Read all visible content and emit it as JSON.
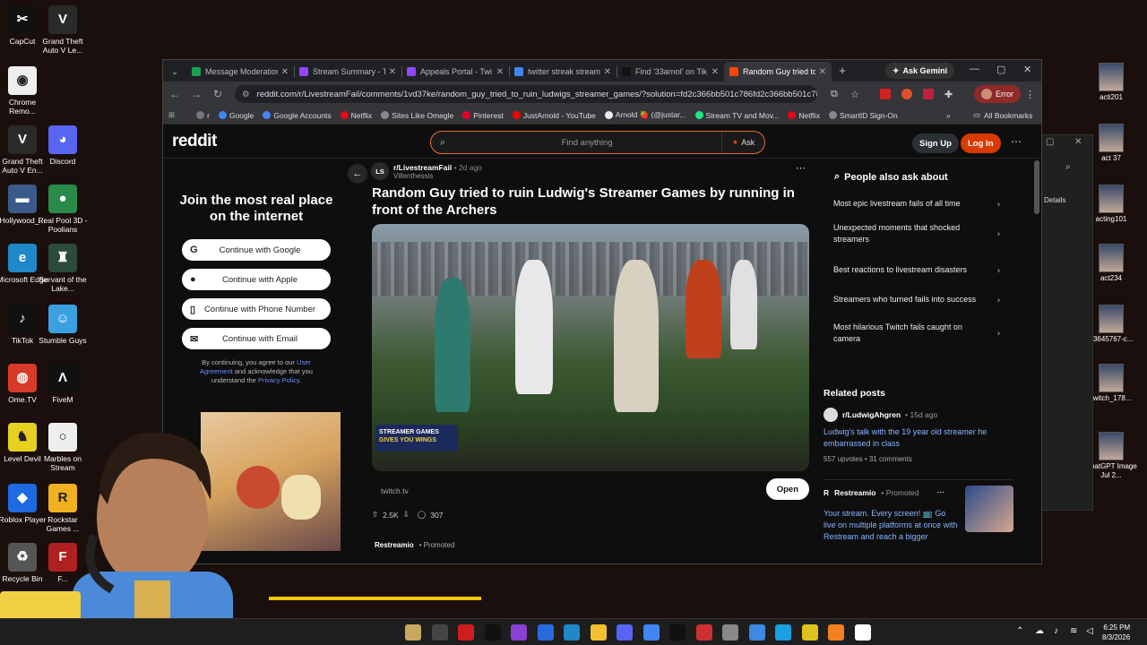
{
  "desktop": {
    "icons_left": [
      {
        "label": "CapCut",
        "glyph": "✂",
        "color": "#111111"
      },
      {
        "label": "Grand Theft Auto V Le...",
        "glyph": "V",
        "color": "#2a2a2a"
      },
      {
        "label": "Chrome Remo...",
        "glyph": "◉",
        "color": "#eeeeee"
      },
      {
        "label": "Grand Theft Auto V En...",
        "glyph": "V",
        "color": "#2a2a2a"
      },
      {
        "label": "Discord",
        "glyph": "◕",
        "color": "#5865f2"
      },
      {
        "label": "Hollywood_...",
        "glyph": "▬",
        "color": "#3a5a8a"
      },
      {
        "label": "Real Pool 3D - Poolians",
        "glyph": "●",
        "color": "#2a8a4a"
      },
      {
        "label": "Microsoft Edge",
        "glyph": "e",
        "color": "#1e88c8"
      },
      {
        "label": "Servant of the Lake...",
        "glyph": "♜",
        "color": "#2a4a3a"
      },
      {
        "label": "TikTok",
        "glyph": "♪",
        "color": "#111111"
      },
      {
        "label": "Stumble Guys",
        "glyph": "☺",
        "color": "#3aa0e0"
      },
      {
        "label": "Ome.TV",
        "glyph": "◍",
        "color": "#d83a2a"
      },
      {
        "label": "FiveM",
        "glyph": "Λ",
        "color": "#111111"
      },
      {
        "label": "Level Devil",
        "glyph": "♞",
        "color": "#e8d020"
      },
      {
        "label": "Marbles on Stream",
        "glyph": "○",
        "color": "#eeeeee"
      },
      {
        "label": "Roblox Player",
        "glyph": "◆",
        "color": "#1e6ae0"
      },
      {
        "label": "Rockstar Games ...",
        "glyph": "R",
        "color": "#f0b020"
      },
      {
        "label": "Recycle Bin",
        "glyph": "♻",
        "color": "#555555"
      },
      {
        "label": "F...",
        "glyph": "F",
        "color": "#b02020"
      }
    ],
    "icons_right": [
      {
        "label": "acti201"
      },
      {
        "label": "act 37"
      },
      {
        "label": "acting101"
      },
      {
        "label": "act234"
      },
      {
        "label": "63645767-c..."
      },
      {
        "label": "twitch_178..."
      },
      {
        "label": "ChatGPT Image Jul 2..."
      }
    ],
    "bg_window": {
      "details_label": "Details"
    }
  },
  "browser": {
    "tabs": [
      {
        "title": "Message Moderation",
        "color": "#1aa052"
      },
      {
        "title": "Stream Summary - T",
        "color": "#9146ff"
      },
      {
        "title": "Appeals Portal - Twi",
        "color": "#9146ff"
      },
      {
        "title": "twitter streak stream",
        "color": "#4285f4"
      },
      {
        "title": "Find '33arnol' on Tik",
        "color": "#111111"
      },
      {
        "title": "Random Guy tried to",
        "color": "#ff4500"
      }
    ],
    "new_tab": "+",
    "gemini": "Ask Gemini",
    "url": "reddit.com/r/LivestreamFail/comments/1vd37ke/random_guy_tried_to_ruin_ludwigs_streamer_games/?solution=fd2c366bb501c786fd2c366bb501c786...",
    "profile_status": "Error",
    "bookmarks": [
      {
        "label": "r",
        "color": "#777777"
      },
      {
        "label": "Google",
        "color": "#4285f4"
      },
      {
        "label": "Google Accounts",
        "color": "#4285f4"
      },
      {
        "label": "Netflix",
        "color": "#e50914"
      },
      {
        "label": "Sites Like Omegle",
        "color": "#888888"
      },
      {
        "label": "Pinterest",
        "color": "#e60023"
      },
      {
        "label": "JustArnold - YouTube",
        "color": "#ff0000"
      },
      {
        "label": "Arnold 🍓 (@justar...",
        "color": "#eeeeee"
      },
      {
        "label": "Stream TV and Mov...",
        "color": "#1ce783"
      },
      {
        "label": "Netflix",
        "color": "#e50914"
      },
      {
        "label": "SmartID Sign-On",
        "color": "#888888"
      }
    ],
    "all_bookmarks": "All Bookmarks"
  },
  "reddit": {
    "logo": "reddit",
    "search_placeholder": "Find anything",
    "ask": "Ask",
    "signup": "Sign Up",
    "login": "Log In",
    "join_title": "Join the most real place on the internet",
    "auth_buttons": [
      {
        "icon": "G",
        "label": "Continue with Google"
      },
      {
        "icon": "",
        "label": "Continue with Apple"
      },
      {
        "icon": "▯",
        "label": "Continue with Phone Number"
      },
      {
        "icon": "✉",
        "label": "Continue with Email"
      }
    ],
    "terms": {
      "pre": "By continuing, you agree to our",
      "link1": "User Agreement",
      "mid": "and acknowledge that you understand the",
      "link2": "Privacy Policy",
      "end": "."
    },
    "post": {
      "sub_avatar": "LS",
      "subreddit": "r/LivestreamFail",
      "age": "• 2d ago",
      "author": "Villenthessis",
      "title": "Random Guy tried to ruin Ludwig's Streamer Games by running in front of the Archers",
      "media_badge": "STREAMER GAMES",
      "media_badge2": "GIVES YOU WINGS",
      "domain": "twitch.tv",
      "open": "Open",
      "upvotes": "2.5K",
      "comments": "307",
      "next_sub": "Restreamio",
      "next_tag": "• Promoted"
    },
    "people_also_ask": {
      "title": "People also ask about",
      "items": [
        "Most epic livestream fails of all time",
        "Unexpected moments that shocked streamers",
        "Best reactions to livestream disasters",
        "Streamers who turned fails into success",
        "Most hilarious Twitch fails caught on camera"
      ]
    },
    "related": {
      "title": "Related posts",
      "sub": "r/LudwigAhgren",
      "age": "• 15d ago",
      "post_title": "Ludwig's talk with the 19 year old streamer he embarrassed in class",
      "stats": "557 upvotes • 31 comments",
      "promo_sub": "Restreamio",
      "promo_tag": "• Promoted",
      "promo_text": "Your stream. Every screen! 📺 Go live on multiple platforms at once with Restream and reach a bigger"
    }
  },
  "taskbar": {
    "time": "6:25 PM",
    "date": "8/3/2026",
    "apps": [
      "#c8a860",
      "#444444",
      "#cc2020",
      "#111111",
      "#8a40d0",
      "#2a6ae0",
      "#1e88c8",
      "#f0c030",
      "#5865f2",
      "#4285f4",
      "#111111",
      "#cc3030",
      "#888888",
      "#3a8ae0",
      "#1aa0e0",
      "#e0c020",
      "#f08020",
      "#ffffff"
    ]
  }
}
